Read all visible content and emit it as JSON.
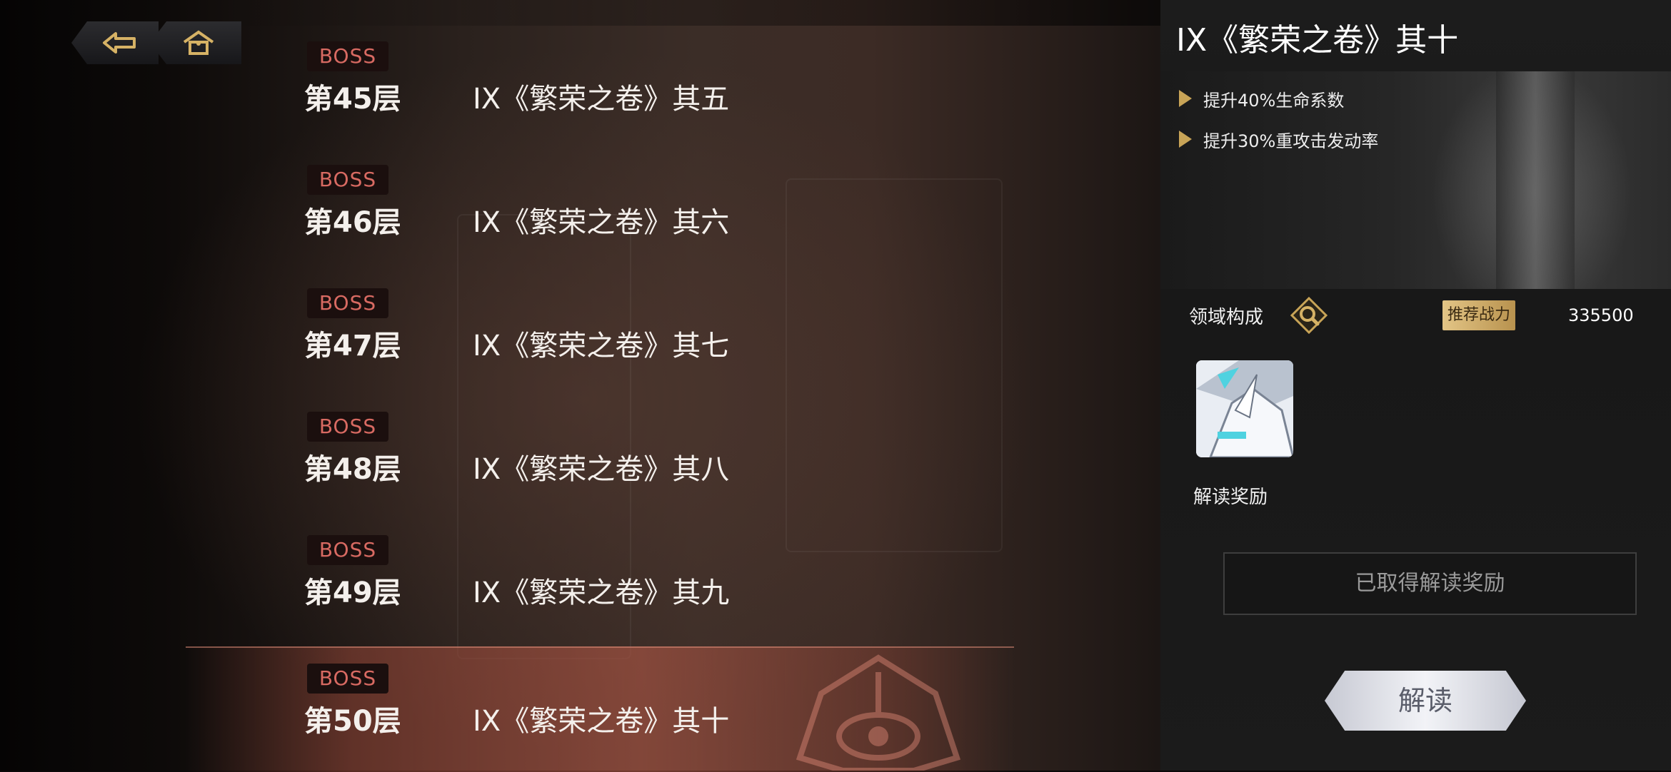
{
  "nav": {
    "back_icon": "back-arrow-icon",
    "home_icon": "home-icon"
  },
  "floors": [
    {
      "badge": "BOSS",
      "floor": "第45层",
      "name": "IX《繁荣之卷》其五"
    },
    {
      "badge": "BOSS",
      "floor": "第46层",
      "name": "IX《繁荣之卷》其六"
    },
    {
      "badge": "BOSS",
      "floor": "第47层",
      "name": "IX《繁荣之卷》其七"
    },
    {
      "badge": "BOSS",
      "floor": "第48层",
      "name": "IX《繁荣之卷》其八"
    },
    {
      "badge": "BOSS",
      "floor": "第49层",
      "name": "IX《繁荣之卷》其九"
    },
    {
      "badge": "BOSS",
      "floor": "第50层",
      "name": "IX《繁荣之卷》其十"
    }
  ],
  "selected_index": 5,
  "detail": {
    "title": "IX《繁荣之卷》其十",
    "buffs": [
      "提升40%生命系数",
      "提升30%重攻击发动率"
    ],
    "domain_label": "领域构成",
    "recommended_power_label": "推荐战力",
    "recommended_power_value": "335500",
    "reward_label": "解读奖励",
    "reward_status": "已取得解读奖励",
    "read_button": "解读"
  },
  "colors": {
    "boss_badge_text": "#d86a62",
    "accent_gold": "#c8a457",
    "selected_row": "#a85544"
  }
}
